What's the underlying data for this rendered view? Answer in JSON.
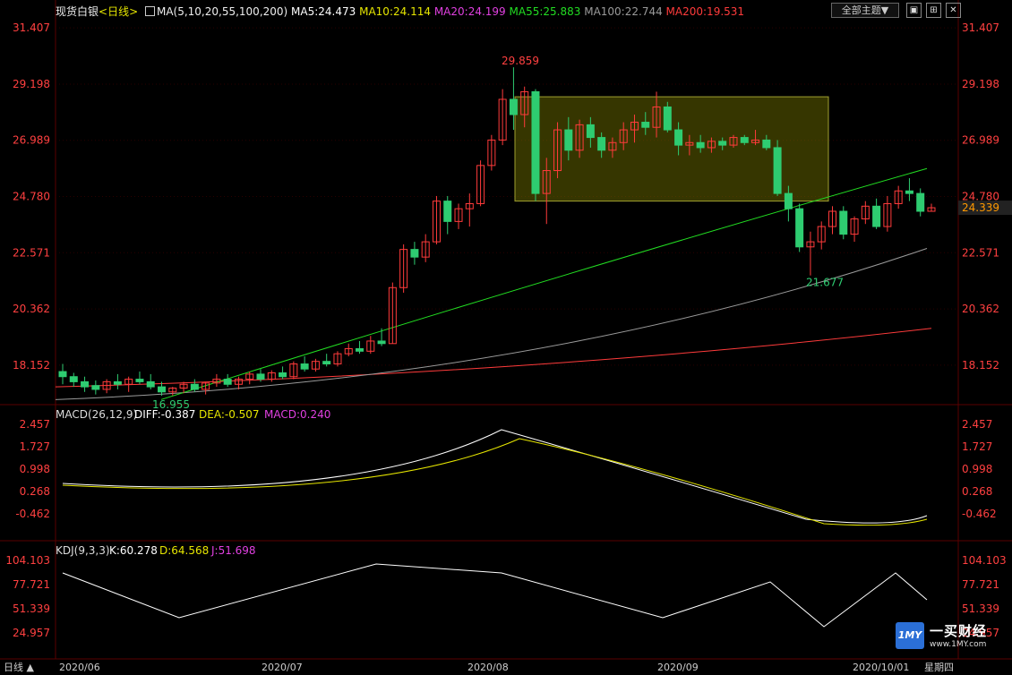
{
  "header": {
    "instrument": "现货白银",
    "period": "<日线>",
    "ma_params": "MA(5,10,20,55,100,200)",
    "ma_values": [
      {
        "label": "MA5:24.473",
        "color": "#ffffff"
      },
      {
        "label": "MA10:24.114",
        "color": "#e6e600"
      },
      {
        "label": "MA20:24.199",
        "color": "#e040e0"
      },
      {
        "label": "MA55:25.883",
        "color": "#22dd22"
      },
      {
        "label": "MA100:22.744",
        "color": "#9a9a9a"
      },
      {
        "label": "MA200:19.531",
        "color": "#ff3b3b"
      }
    ],
    "theme_button": "全部主题▼"
  },
  "price_axis": {
    "ticks": [
      "31.407",
      "29.198",
      "26.989",
      "24.780",
      "22.571",
      "20.362",
      "18.152"
    ],
    "current": "24.339"
  },
  "annotations": {
    "high": "29.859",
    "low_jul": "16.955",
    "low_sep": "21.677"
  },
  "macd": {
    "title": "MACD(26,12,9)",
    "diff": "DIFF:-0.387",
    "dea": "DEA:-0.507",
    "macd": "MACD:0.240",
    "ticks": [
      "2.457",
      "1.727",
      "0.998",
      "0.268",
      "-0.462"
    ]
  },
  "kdj": {
    "title": "KDJ(9,3,3)",
    "k": "K:60.278",
    "d": "D:64.568",
    "j": "J:51.698",
    "ticks": [
      "104.103",
      "77.721",
      "51.339",
      "24.957"
    ]
  },
  "dates": [
    "2020/06",
    "2020/07",
    "2020/08",
    "2020/09",
    "2020/10/01",
    "星期四"
  ],
  "period_tab": "日线 ▲",
  "logo": {
    "mark": "1MY",
    "name": "一买财经",
    "url": "www.1MY.com"
  },
  "colors": {
    "up": "#ff3b3b",
    "down": "#2ecc71",
    "grid": "#5a0000"
  },
  "chart_data": {
    "type": "candlestick",
    "ylim": [
      16.6,
      31.8
    ],
    "candles": [
      [
        17.9,
        18.2,
        17.4,
        17.7
      ],
      [
        17.7,
        17.85,
        17.3,
        17.5
      ],
      [
        17.5,
        17.7,
        17.1,
        17.3
      ],
      [
        17.35,
        17.55,
        17.0,
        17.2
      ],
      [
        17.2,
        17.6,
        17.05,
        17.5
      ],
      [
        17.5,
        17.8,
        17.2,
        17.4
      ],
      [
        17.4,
        17.7,
        17.1,
        17.6
      ],
      [
        17.6,
        17.9,
        17.4,
        17.5
      ],
      [
        17.5,
        17.8,
        17.2,
        17.3
      ],
      [
        17.3,
        17.5,
        16.955,
        17.1
      ],
      [
        17.1,
        17.3,
        16.96,
        17.25
      ],
      [
        17.25,
        17.5,
        17.05,
        17.4
      ],
      [
        17.4,
        17.6,
        17.1,
        17.2
      ],
      [
        17.2,
        17.5,
        17.0,
        17.45
      ],
      [
        17.45,
        17.8,
        17.3,
        17.6
      ],
      [
        17.6,
        17.8,
        17.3,
        17.4
      ],
      [
        17.4,
        17.7,
        17.2,
        17.6
      ],
      [
        17.6,
        17.9,
        17.4,
        17.8
      ],
      [
        17.8,
        18.0,
        17.5,
        17.6
      ],
      [
        17.6,
        17.95,
        17.5,
        17.85
      ],
      [
        17.85,
        18.1,
        17.6,
        17.7
      ],
      [
        17.7,
        18.3,
        17.6,
        18.2
      ],
      [
        18.2,
        18.5,
        17.9,
        18.0
      ],
      [
        18.0,
        18.4,
        17.9,
        18.3
      ],
      [
        18.3,
        18.6,
        18.1,
        18.2
      ],
      [
        18.2,
        18.7,
        18.1,
        18.6
      ],
      [
        18.6,
        19.0,
        18.5,
        18.8
      ],
      [
        18.8,
        19.1,
        18.6,
        18.7
      ],
      [
        18.7,
        19.3,
        18.6,
        19.1
      ],
      [
        19.1,
        19.6,
        18.9,
        19.0
      ],
      [
        19.0,
        21.4,
        19.0,
        21.2
      ],
      [
        21.2,
        22.9,
        21.0,
        22.7
      ],
      [
        22.7,
        23.0,
        22.1,
        22.4
      ],
      [
        22.4,
        23.3,
        22.2,
        23.0
      ],
      [
        23.0,
        24.8,
        22.9,
        24.6
      ],
      [
        24.6,
        24.8,
        23.3,
        23.8
      ],
      [
        23.8,
        24.5,
        23.5,
        24.3
      ],
      [
        24.3,
        24.9,
        23.6,
        24.5
      ],
      [
        24.5,
        26.2,
        24.4,
        26.0
      ],
      [
        26.0,
        27.2,
        25.8,
        27.0
      ],
      [
        27.0,
        29.0,
        26.8,
        28.6
      ],
      [
        28.6,
        29.859,
        27.4,
        28.0
      ],
      [
        28.0,
        29.1,
        27.5,
        28.9
      ],
      [
        28.9,
        29.0,
        24.6,
        24.9
      ],
      [
        24.9,
        26.3,
        23.7,
        25.8
      ],
      [
        25.8,
        27.7,
        25.5,
        27.4
      ],
      [
        27.4,
        27.9,
        26.2,
        26.6
      ],
      [
        26.6,
        27.8,
        26.3,
        27.6
      ],
      [
        27.6,
        27.9,
        26.7,
        27.1
      ],
      [
        27.1,
        27.3,
        26.3,
        26.6
      ],
      [
        26.6,
        27.1,
        26.3,
        26.9
      ],
      [
        26.9,
        27.7,
        26.6,
        27.4
      ],
      [
        27.4,
        28.0,
        26.9,
        27.7
      ],
      [
        27.7,
        28.1,
        27.2,
        27.5
      ],
      [
        27.5,
        28.9,
        27.1,
        28.3
      ],
      [
        28.3,
        28.5,
        27.3,
        27.4
      ],
      [
        27.4,
        27.7,
        26.4,
        26.8
      ],
      [
        26.8,
        27.2,
        26.4,
        26.9
      ],
      [
        26.9,
        27.2,
        26.5,
        26.7
      ],
      [
        26.7,
        27.1,
        26.5,
        26.95
      ],
      [
        26.95,
        27.1,
        26.6,
        26.8
      ],
      [
        26.8,
        27.2,
        26.7,
        27.1
      ],
      [
        27.1,
        27.2,
        26.8,
        26.9
      ],
      [
        26.9,
        27.4,
        26.8,
        27.0
      ],
      [
        27.0,
        27.2,
        26.6,
        26.7
      ],
      [
        26.7,
        27.0,
        24.8,
        24.9
      ],
      [
        24.9,
        25.2,
        23.8,
        24.3
      ],
      [
        24.3,
        24.5,
        22.6,
        22.8
      ],
      [
        22.8,
        23.4,
        21.677,
        23.0
      ],
      [
        23.0,
        23.8,
        22.7,
        23.6
      ],
      [
        23.6,
        24.4,
        23.3,
        24.2
      ],
      [
        24.2,
        24.4,
        23.1,
        23.3
      ],
      [
        23.3,
        24.0,
        23.0,
        23.9
      ],
      [
        23.9,
        24.6,
        23.7,
        24.4
      ],
      [
        24.4,
        24.7,
        23.5,
        23.6
      ],
      [
        23.6,
        24.8,
        23.4,
        24.5
      ],
      [
        24.5,
        25.2,
        24.3,
        25.0
      ],
      [
        25.0,
        25.5,
        24.6,
        24.9
      ],
      [
        24.9,
        25.1,
        24.0,
        24.2
      ],
      [
        24.2,
        24.5,
        24.2,
        24.339
      ]
    ]
  }
}
